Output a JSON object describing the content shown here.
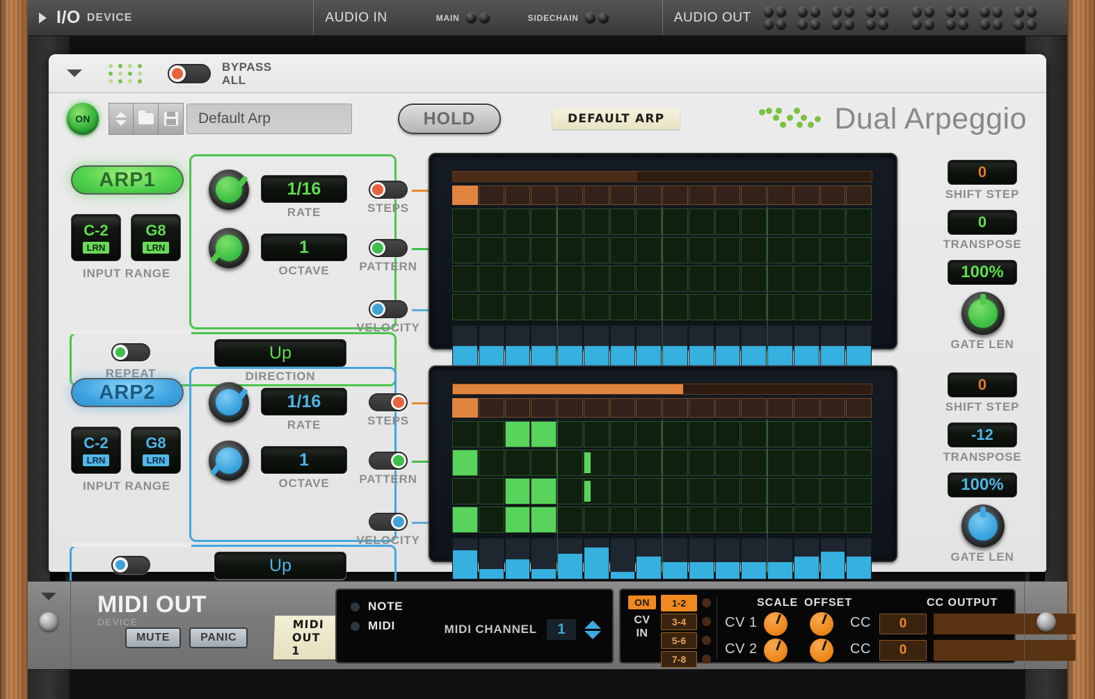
{
  "io_bar": {
    "title": "I/O",
    "subtitle": "DEVICE",
    "audio_in_label": "AUDIO IN",
    "main_label": "MAIN",
    "sidechain_label": "SIDECHAIN",
    "audio_out_label": "AUDIO OUT"
  },
  "header": {
    "bypass_line1": "BYPASS",
    "bypass_line2": "ALL",
    "on_label": "ON",
    "preset_name": "Default Arp",
    "hold_label": "HOLD",
    "tape_label": "DEFAULT ARP",
    "brand_name": "Dual Arpeggio"
  },
  "captions": {
    "rate": "RATE",
    "octave": "OCTAVE",
    "input_range": "INPUT RANGE",
    "repeat": "REPEAT",
    "direction": "DIRECTION",
    "steps": "STEPS",
    "pattern": "PATTERN",
    "velocity": "VELOCITY",
    "shift_step": "SHIFT STEP",
    "transpose": "TRANSPOSE",
    "gate_len": "GATE LEN",
    "lrn": "LRN"
  },
  "colors": {
    "arp1_accent": "#49c64a",
    "arp2_accent": "#41a7de",
    "steps_accent": "#e8623c",
    "pattern_accent": "#3fbf4a",
    "velocity_accent": "#3fa3d6",
    "orange": "#e0853f",
    "lcd_green": "#5fdc4f",
    "lcd_blue": "#4fb5e8",
    "lcd_orange": "#e07b2a"
  },
  "arp1": {
    "badge": "ARP1",
    "rate": "1/16",
    "octave": "1",
    "note_low": "C-2",
    "note_high": "G8",
    "direction": "Up",
    "shift_step": "0",
    "transpose": "0",
    "gate_len": "100%",
    "grid": {
      "steps": 16,
      "length_fill_pct": 44,
      "length_bar_active": false,
      "active_step": 1,
      "pattern_rows": 4,
      "pattern": [
        [
          0,
          0,
          0,
          0,
          0,
          0,
          0,
          0,
          0,
          0,
          0,
          0,
          0,
          0,
          0,
          0
        ],
        [
          0,
          0,
          0,
          0,
          0,
          0,
          0,
          0,
          0,
          0,
          0,
          0,
          0,
          0,
          0,
          0
        ],
        [
          0,
          0,
          0,
          0,
          0,
          0,
          0,
          0,
          0,
          0,
          0,
          0,
          0,
          0,
          0,
          0
        ],
        [
          0,
          0,
          0,
          0,
          0,
          0,
          0,
          0,
          0,
          0,
          0,
          0,
          0,
          0,
          0,
          0
        ]
      ],
      "velocity": [
        50,
        50,
        50,
        50,
        50,
        50,
        50,
        50,
        50,
        50,
        50,
        50,
        50,
        50,
        50,
        50
      ]
    }
  },
  "arp2": {
    "badge": "ARP2",
    "rate": "1/16",
    "octave": "1",
    "note_low": "C-2",
    "note_high": "G8",
    "direction": "Up",
    "shift_step": "0",
    "transpose": "-12",
    "gate_len": "100%",
    "grid": {
      "steps": 16,
      "length_fill_pct": 55,
      "length_bar_active": true,
      "active_step": 1,
      "pattern_rows": 4,
      "pattern": [
        [
          0,
          0,
          1,
          1,
          0,
          0,
          0,
          0,
          0,
          0,
          0,
          0,
          0,
          0,
          0,
          0
        ],
        [
          1,
          0,
          0,
          0,
          0,
          0,
          0,
          0,
          0,
          0,
          0,
          0,
          0,
          0,
          0,
          0
        ],
        [
          0,
          0,
          1,
          1,
          0,
          0,
          0,
          0,
          0,
          0,
          0,
          0,
          0,
          0,
          0,
          0
        ],
        [
          1,
          0,
          1,
          1,
          0,
          0,
          0,
          0,
          0,
          0,
          0,
          0,
          0,
          0,
          0,
          0
        ]
      ],
      "pattern_partial": [
        [],
        [
          {
            "col": 6,
            "width": 28
          }
        ],
        [
          {
            "col": 6,
            "width": 28
          }
        ],
        []
      ],
      "velocity": [
        70,
        25,
        48,
        25,
        62,
        78,
        18,
        55,
        42,
        42,
        42,
        42,
        42,
        55,
        68,
        55
      ]
    }
  },
  "midi_out": {
    "title": "MIDI OUT",
    "subtitle": "DEVICE",
    "mute_label": "MUTE",
    "panic_label": "PANIC",
    "tape_label": "MIDI OUT 1",
    "note_label": "NOTE",
    "midi_label": "MIDI",
    "midi_channel_label": "MIDI CHANNEL",
    "midi_channel_value": "1"
  },
  "cv_panel": {
    "on_label": "ON",
    "cv_label_line1": "CV",
    "cv_label_line2": "IN",
    "pairs": [
      "1-2",
      "3-4",
      "5-6",
      "7-8"
    ],
    "active_pair": "1-2",
    "scale_label": "SCALE",
    "offset_label": "OFFSET",
    "cc_output_label": "CC OUTPUT",
    "rows": [
      {
        "name": "CV 1",
        "cc_label": "CC",
        "cc_value": "0"
      },
      {
        "name": "CV 2",
        "cc_label": "CC",
        "cc_value": "0"
      }
    ]
  }
}
